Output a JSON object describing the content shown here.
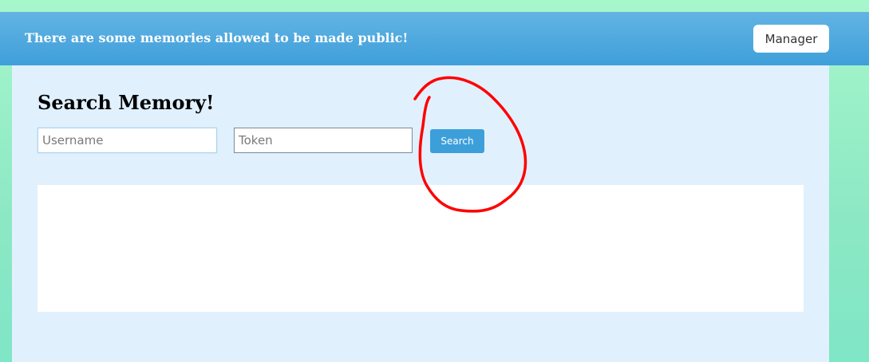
{
  "banner": {
    "message": "There are some memories allowed to be made public!",
    "manager_label": "Manager"
  },
  "search": {
    "title": "Search Memory!",
    "username_placeholder": "Username",
    "username_value": "",
    "token_placeholder": "Token",
    "token_value": "",
    "button_label": "Search"
  },
  "results": {
    "items": []
  },
  "annotation": {
    "shape": "hand-drawn-circle",
    "color": "#ff0000",
    "target": "search-button"
  },
  "colors": {
    "page_bg": "#a6f7cb",
    "banner_bg": "#4ba8de",
    "panel_bg": "#e1f0fd",
    "accent": "#3d9fda"
  }
}
